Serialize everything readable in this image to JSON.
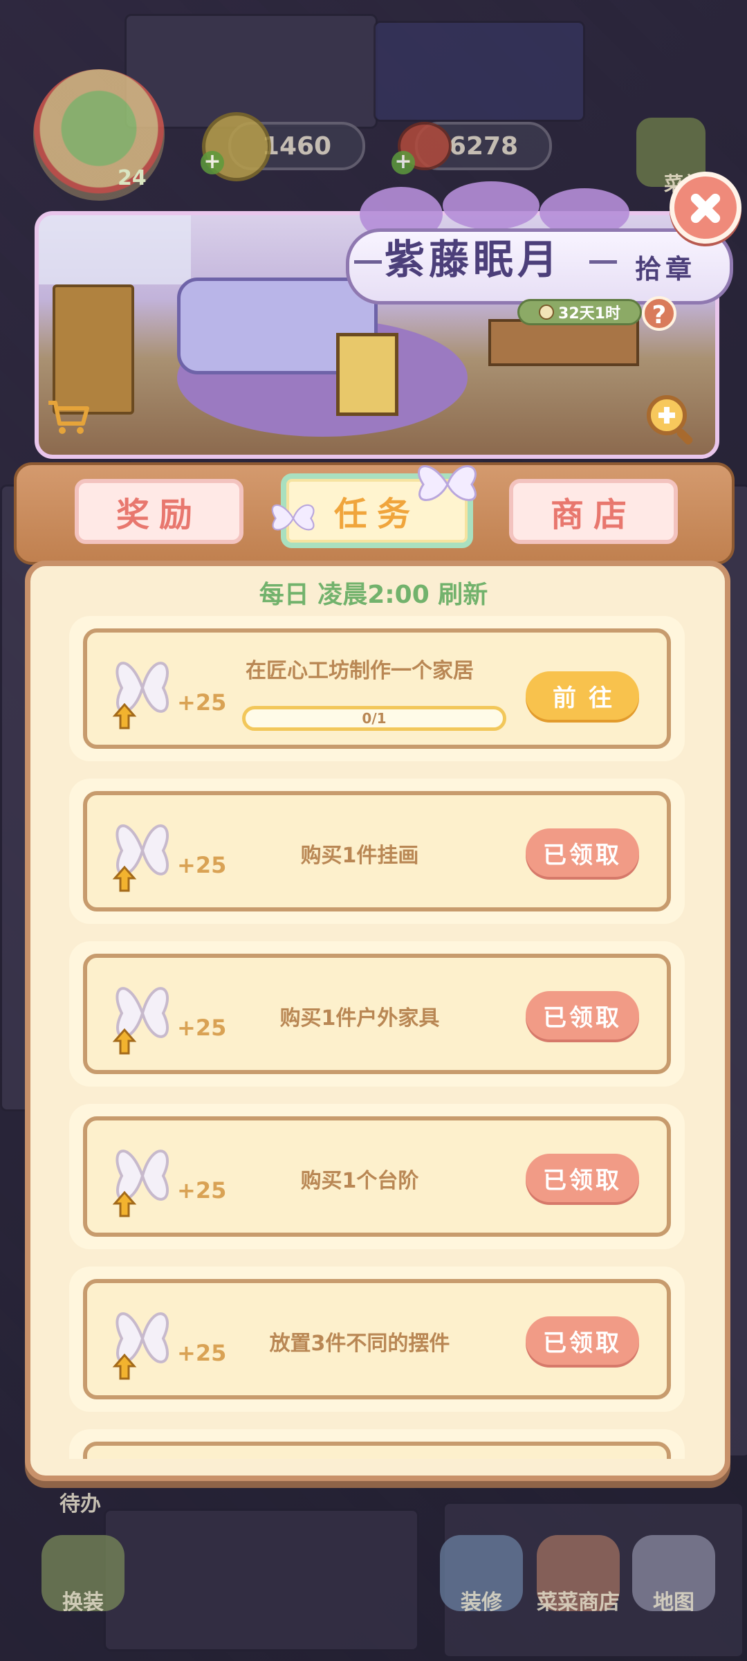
{
  "hud": {
    "player_level": "24",
    "coins": "1460",
    "berries": "6278",
    "menu_label": "菜单"
  },
  "banner": {
    "title": "紫藤眠月",
    "badge": "拾章",
    "time_left": "32天1时",
    "help": "?"
  },
  "tabs": [
    {
      "label": "奖励",
      "active": false
    },
    {
      "label": "任务",
      "active": true
    },
    {
      "label": "商店",
      "active": false
    }
  ],
  "refresh_note": "每日 凌晨2:00 刷新",
  "tasks": [
    {
      "title": "在匠心工坊制作一个家居",
      "reward": "+25",
      "progress": "0/1",
      "button": "前往",
      "state": "go"
    },
    {
      "title": "购买1件挂画",
      "reward": "+25",
      "button": "已领取",
      "state": "claimed"
    },
    {
      "title": "购买1件户外家具",
      "reward": "+25",
      "button": "已领取",
      "state": "claimed"
    },
    {
      "title": "购买1个台阶",
      "reward": "+25",
      "button": "已领取",
      "state": "claimed"
    },
    {
      "title": "放置3件不同的摆件",
      "reward": "+25",
      "button": "已领取",
      "state": "claimed"
    }
  ],
  "bottom_nav": {
    "todo": "待办",
    "dress": "换装",
    "decorate": "装修",
    "shop": "菜菜商店",
    "map": "地图"
  },
  "colors": {
    "tab_active_text": "#f0a53c",
    "tab_inactive_text": "#e8776e",
    "refresh_text": "#72b26c",
    "go_button": "#f8c24d",
    "claimed_button": "#f19b86",
    "panel_bg": "#fbeed2"
  }
}
